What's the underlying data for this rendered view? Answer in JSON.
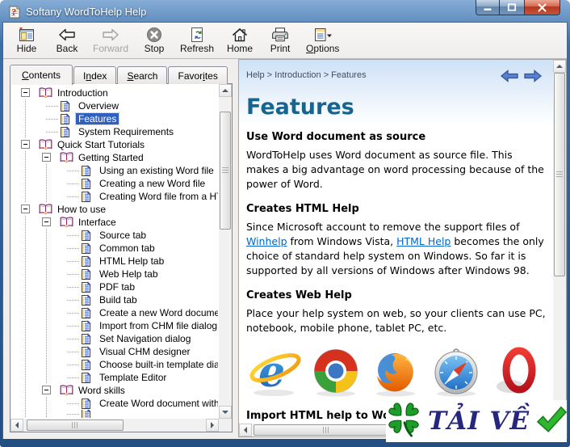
{
  "window": {
    "title": "Softany WordToHelp Help"
  },
  "window_controls": [
    {
      "id": "minimize",
      "label": "minimize"
    },
    {
      "id": "maximize",
      "label": "maximize"
    },
    {
      "id": "close",
      "label": "close"
    }
  ],
  "toolbar": {
    "buttons": [
      {
        "id": "hide",
        "label": "Hide",
        "enabled": true
      },
      {
        "id": "back",
        "label": "Back",
        "enabled": true
      },
      {
        "id": "forward",
        "label": "Forward",
        "enabled": false
      },
      {
        "id": "stop",
        "label": "Stop",
        "enabled": true
      },
      {
        "id": "refresh",
        "label": "Refresh",
        "enabled": true
      },
      {
        "id": "home",
        "label": "Home",
        "enabled": true
      },
      {
        "id": "print",
        "label": "Print",
        "enabled": true
      },
      {
        "id": "options",
        "label": "Options",
        "enabled": true,
        "underline": 0,
        "dropdown": true
      }
    ]
  },
  "tabs": [
    {
      "label": "Contents",
      "underline": 0,
      "active": true
    },
    {
      "label": "Index",
      "underline": 1,
      "active": false
    },
    {
      "label": "Search",
      "underline": 0,
      "active": false
    },
    {
      "label": "Favorites",
      "underline": 5,
      "active": false
    }
  ],
  "tree": {
    "items": [
      {
        "label": "Introduction",
        "type": "book",
        "level": 1,
        "toggle": "minus"
      },
      {
        "label": "Overview",
        "type": "page",
        "level": 2
      },
      {
        "label": "Features",
        "type": "page",
        "level": 2,
        "selected": true
      },
      {
        "label": "System Requirements",
        "type": "page",
        "level": 2
      },
      {
        "label": "Quick Start Tutorials",
        "type": "book",
        "level": 1,
        "toggle": "minus"
      },
      {
        "label": "Getting Started",
        "type": "book",
        "level": 2,
        "toggle": "minus"
      },
      {
        "label": "Using an existing Word file",
        "type": "page",
        "level": 3
      },
      {
        "label": "Creating a new Word file",
        "type": "page",
        "level": 3
      },
      {
        "label": "Creating Word file from a HTML",
        "type": "page",
        "level": 3
      },
      {
        "label": "How to use",
        "type": "book",
        "level": 1,
        "toggle": "minus"
      },
      {
        "label": "Interface",
        "type": "book",
        "level": 2,
        "toggle": "minus"
      },
      {
        "label": "Source tab",
        "type": "page",
        "level": 3
      },
      {
        "label": "Common tab",
        "type": "page",
        "level": 3
      },
      {
        "label": "HTML Help tab",
        "type": "page",
        "level": 3
      },
      {
        "label": "Web Help tab",
        "type": "page",
        "level": 3
      },
      {
        "label": "PDF tab",
        "type": "page",
        "level": 3
      },
      {
        "label": "Build tab",
        "type": "page",
        "level": 3
      },
      {
        "label": "Create a new Word document",
        "type": "page",
        "level": 3
      },
      {
        "label": "Import from CHM file dialog",
        "type": "page",
        "level": 3
      },
      {
        "label": "Set Navigation dialog",
        "type": "page",
        "level": 3
      },
      {
        "label": "Visual CHM designer",
        "type": "page",
        "level": 3
      },
      {
        "label": "Choose built-in template dialog",
        "type": "page",
        "level": 3
      },
      {
        "label": "Template Editor",
        "type": "page",
        "level": 3
      },
      {
        "label": "Word skills",
        "type": "book",
        "level": 2,
        "toggle": "minus"
      },
      {
        "label": "Create Word document with ou",
        "type": "page",
        "level": 3
      },
      {
        "label": "",
        "type": "page",
        "level": 3,
        "partial": true
      }
    ]
  },
  "content": {
    "breadcrumb": "Help > Introduction > Features",
    "title": "Features",
    "sections": [
      {
        "heading": "Use Word document as source",
        "paragraphs": [
          [
            {
              "text": "WordToHelp uses Word document as source file. This makes a big advantage on word processing because of the power of Word."
            }
          ]
        ]
      },
      {
        "heading": "Creates HTML Help",
        "paragraphs": [
          [
            {
              "text": "Since Microsoft account to remove the support files of "
            },
            {
              "text": "Winhelp",
              "link": true
            },
            {
              "text": " from Windows Vista, "
            },
            {
              "text": "HTML Help",
              "link": true
            },
            {
              "text": " becomes the only choice of standard help system on Windows. So far it is supported by all versions of Windows after Windows 98."
            }
          ]
        ]
      },
      {
        "heading": "Creates Web Help",
        "paragraphs": [
          [
            {
              "text": "Place your help system on web, so your clients can use PC, notebook, mobile phone, tablet PC, etc."
            }
          ]
        ],
        "browsers": [
          {
            "name": "internet-explorer"
          },
          {
            "name": "chrome"
          },
          {
            "name": "firefox"
          },
          {
            "name": "safari"
          },
          {
            "name": "opera"
          }
        ]
      },
      {
        "heading": "Import HTML help to Word file"
      }
    ]
  },
  "watermark": {
    "text": "TẢI VỀ"
  },
  "colors": {
    "titlebar_blue": "#3b6ea8",
    "tree_selection": "#2e5fc1",
    "link": "#0066cc",
    "topic_heading": "#17648f",
    "nav_arrow": "#5b7fd0",
    "watermark_text": "#26267e",
    "clover_green": "#1d9e28",
    "check_green": "#2fb62f"
  }
}
